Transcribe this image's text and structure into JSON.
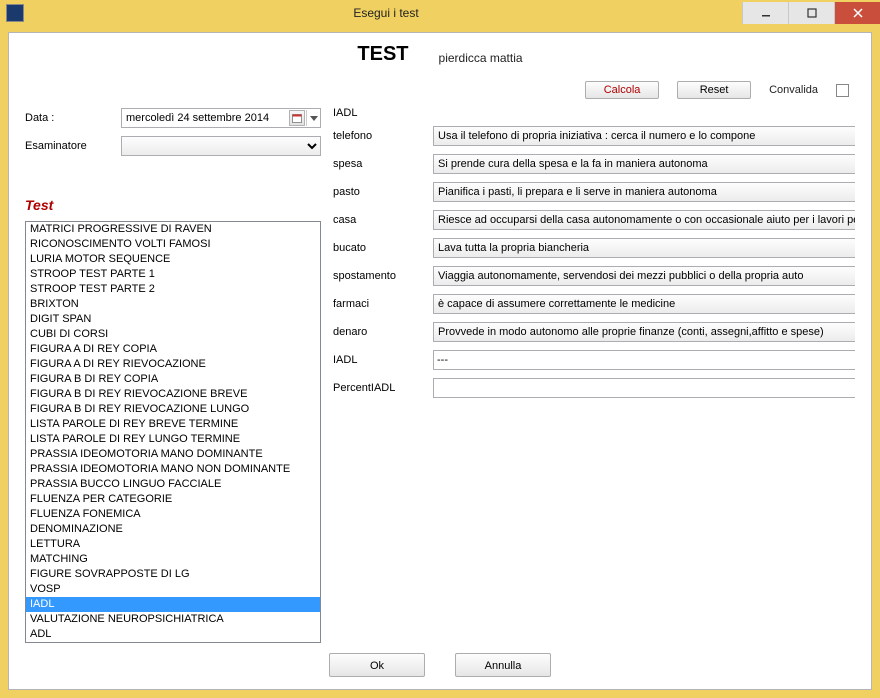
{
  "window": {
    "title": "Esegui i test"
  },
  "header": {
    "title": "TEST",
    "patient": "pierdicca mattia"
  },
  "actions": {
    "calcola": "Calcola",
    "reset": "Reset",
    "convalida": "Convalida"
  },
  "left": {
    "data_label": "Data :",
    "data_value": "mercoledì 24 settembre 2014",
    "esaminatore_label": "Esaminatore",
    "esaminatore_value": "",
    "section_title": "Test",
    "tests": [
      "MATRICI PROGRESSIVE DI RAVEN",
      "RICONOSCIMENTO VOLTI FAMOSI",
      "LURIA MOTOR SEQUENCE",
      "STROOP TEST PARTE 1",
      "STROOP TEST PARTE 2",
      "BRIXTON",
      "DIGIT SPAN",
      "CUBI DI CORSI",
      "FIGURA A DI REY COPIA",
      "FIGURA A DI REY RIEVOCAZIONE",
      "FIGURA B DI REY COPIA",
      "FIGURA B DI REY RIEVOCAZIONE BREVE",
      "FIGURA B DI REY RIEVOCAZIONE LUNGO",
      "LISTA PAROLE DI REY BREVE TERMINE",
      "LISTA PAROLE DI REY LUNGO TERMINE",
      "PRASSIA IDEOMOTORIA MANO DOMINANTE",
      "PRASSIA IDEOMOTORIA MANO NON DOMINANTE",
      "PRASSIA BUCCO LINGUO FACCIALE",
      "FLUENZA PER CATEGORIE",
      "FLUENZA FONEMICA",
      "DENOMINAZIONE",
      "LETTURA",
      "MATCHING",
      "FIGURE SOVRAPPOSTE DI LG",
      "VOSP",
      "IADL",
      "VALUTAZIONE NEUROPSICHIATRICA",
      "ADL"
    ],
    "selected_test": "IADL"
  },
  "right": {
    "title": "IADL",
    "fields": [
      {
        "label": "telefono",
        "value": "Usa il telefono di propria iniziativa : cerca il numero e lo compone",
        "type": "select"
      },
      {
        "label": "spesa",
        "value": "Si prende cura della spesa e la fa in maniera autonoma",
        "type": "select"
      },
      {
        "label": "pasto",
        "value": "Pianifica i pasti, li prepara e li serve in maniera autonoma",
        "type": "select"
      },
      {
        "label": "casa",
        "value": "Riesce ad occuparsi della casa autonomamente o con occasionale aiuto per i lavori pes",
        "type": "select"
      },
      {
        "label": "bucato",
        "value": "Lava tutta la propria biancheria",
        "type": "select"
      },
      {
        "label": "spostamento",
        "value": "Viaggia autonomamente, servendosi dei mezzi pubblici o della propria auto",
        "type": "select"
      },
      {
        "label": "farmaci",
        "value": "è capace di assumere correttamente le medicine",
        "type": "select"
      },
      {
        "label": "denaro",
        "value": "Provvede in modo autonomo alle proprie finanze (conti, assegni,affitto e spese)",
        "type": "select"
      },
      {
        "label": "IADL",
        "value": "---",
        "type": "text"
      },
      {
        "label": "PercentIADL",
        "value": "",
        "type": "text"
      }
    ]
  },
  "footer": {
    "ok": "Ok",
    "annulla": "Annulla"
  }
}
